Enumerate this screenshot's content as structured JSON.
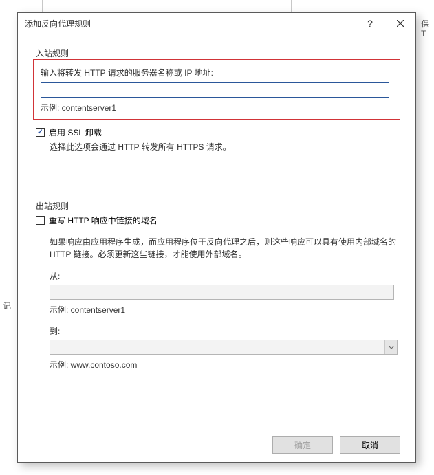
{
  "bg": {
    "top_cells": [
      "",
      "",
      "",
      ""
    ],
    "left": "记",
    "right1": "保",
    "right2": "T"
  },
  "dialog": {
    "title": "添加反向代理规则",
    "help": "?",
    "inbound": {
      "group_title": "入站规则",
      "label": "输入将转发 HTTP 请求的服务器名称或 IP 地址:",
      "value": "",
      "example": "示例: contentserver1",
      "ssl_label": "启用 SSL 卸载",
      "ssl_desc": "选择此选项会通过 HTTP 转发所有 HTTPS 请求。"
    },
    "outbound": {
      "group_title": "出站规则",
      "rewrite_label": "重写 HTTP 响应中链接的域名",
      "desc": "如果响应由应用程序生成，而应用程序位于反向代理之后，则这些响应可以具有使用内部域名的 HTTP 链接。必须更新这些链接，才能使用外部域名。",
      "from_label": "从:",
      "from_value": "",
      "from_example": "示例: contentserver1",
      "to_label": "到:",
      "to_value": "",
      "to_example": "示例: www.contoso.com"
    },
    "buttons": {
      "ok": "确定",
      "cancel": "取消"
    }
  }
}
